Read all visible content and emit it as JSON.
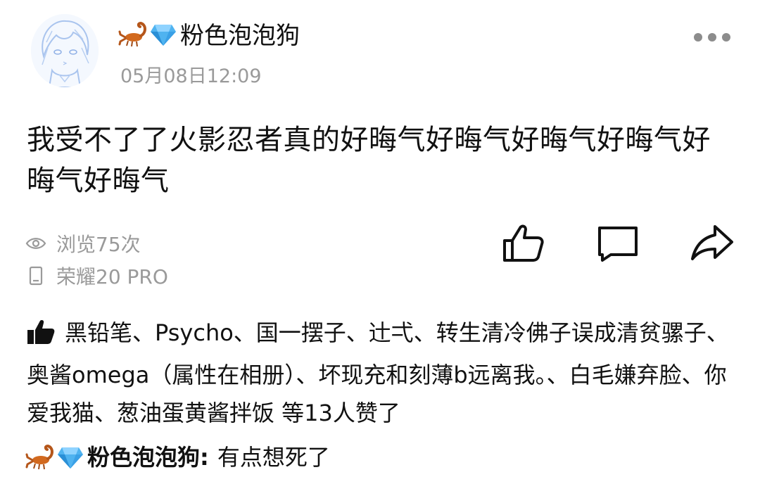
{
  "post": {
    "username": "粉色泡泡狗",
    "timestamp": "05月08日12:09",
    "text": "我受不了了火影忍者真的好晦气好晦气好晦气好晦气好晦气好晦气",
    "views": "浏览75次",
    "device": "荣耀20 PRO"
  },
  "likes": {
    "text": "黑铅笔、Psycho、国一摆子、辻弌、转生清冷佛子误成清贫骡子、奥酱omega（属性在相册）、坏现充和刻薄b远离我。、白毛嫌弃脸、你爱我猫、葱油蛋黄酱拌饭 等13人赞了"
  },
  "comment": {
    "author": "粉色泡泡狗:",
    "text": "有点想死了"
  },
  "icons": {
    "more": "more-dots-icon",
    "like": "thumbs-up-icon",
    "comment": "comment-bubble-icon",
    "share": "share-arrow-icon",
    "views": "eye-icon",
    "device": "phone-icon",
    "username_prefix": [
      "scorpion-emoji",
      "gem-emoji"
    ]
  },
  "colors": {
    "text_primary": "#111111",
    "text_secondary": "#9a9a9a",
    "gem": "#4fb3f0",
    "scorpion": "#d2691e"
  }
}
